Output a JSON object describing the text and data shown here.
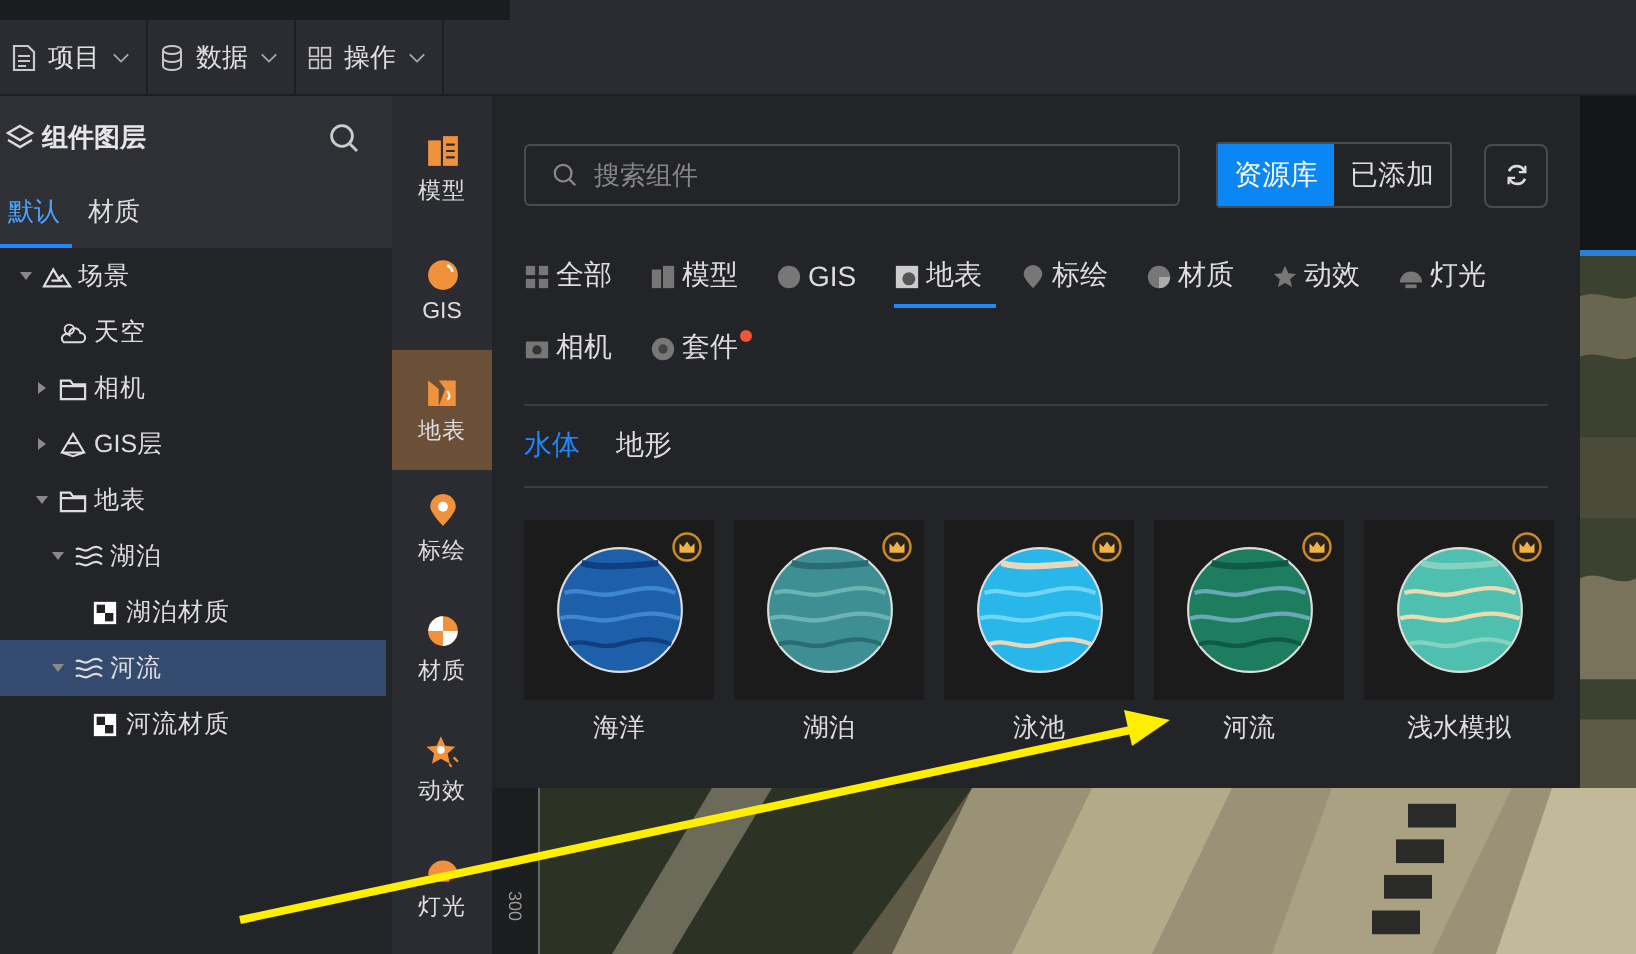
{
  "menu": [
    {
      "label": "项目"
    },
    {
      "label": "数据"
    },
    {
      "label": "操作"
    }
  ],
  "layers_panel": {
    "title": "组件图层",
    "tabs": [
      {
        "label": "默认",
        "selected": true
      },
      {
        "label": "材质",
        "selected": false
      }
    ],
    "tree": [
      {
        "label": "场景",
        "kind": "scene",
        "expanded": true,
        "selected": false,
        "children": [
          {
            "label": "天空",
            "kind": "sky",
            "selected": false
          },
          {
            "label": "相机",
            "kind": "folder",
            "expanded": false,
            "selected": false
          },
          {
            "label": "GIS层",
            "kind": "gis",
            "expanded": false,
            "selected": false
          },
          {
            "label": "地表",
            "kind": "folder",
            "expanded": true,
            "selected": false,
            "children": [
              {
                "label": "湖泊",
                "kind": "water",
                "expanded": true,
                "selected": false,
                "children": [
                  {
                    "label": "湖泊材质",
                    "kind": "material",
                    "selected": false
                  }
                ]
              },
              {
                "label": "河流",
                "kind": "water",
                "expanded": true,
                "selected": true,
                "children": [
                  {
                    "label": "河流材质",
                    "kind": "material",
                    "selected": false
                  }
                ]
              }
            ]
          }
        ]
      }
    ]
  },
  "rail": [
    {
      "label": "模型",
      "selected": false
    },
    {
      "label": "GIS",
      "selected": false
    },
    {
      "label": "地表",
      "selected": true
    },
    {
      "label": "标绘",
      "selected": false
    },
    {
      "label": "材质",
      "selected": false
    },
    {
      "label": "动效",
      "selected": false
    },
    {
      "label": "灯光",
      "selected": false
    }
  ],
  "library": {
    "search": {
      "placeholder": "搜索组件"
    },
    "source_toggle": [
      {
        "label": "资源库",
        "selected": true
      },
      {
        "label": "已添加",
        "selected": false
      }
    ],
    "categories": [
      {
        "label": "全部",
        "selected": false,
        "new": false
      },
      {
        "label": "模型",
        "selected": false,
        "new": false
      },
      {
        "label": "GIS",
        "selected": false,
        "new": false
      },
      {
        "label": "地表",
        "selected": true,
        "new": false
      },
      {
        "label": "标绘",
        "selected": false,
        "new": false
      },
      {
        "label": "材质",
        "selected": false,
        "new": false
      },
      {
        "label": "动效",
        "selected": false,
        "new": false
      },
      {
        "label": "灯光",
        "selected": false,
        "new": false
      },
      {
        "label": "相机",
        "selected": false,
        "new": false
      },
      {
        "label": "套件",
        "selected": false,
        "new": true
      }
    ],
    "subtabs": [
      {
        "label": "水体",
        "selected": true
      },
      {
        "label": "地形",
        "selected": false
      }
    ],
    "cards": [
      {
        "label": "海洋",
        "premium": true
      },
      {
        "label": "湖泊",
        "premium": true
      },
      {
        "label": "泳池",
        "premium": true
      },
      {
        "label": "河流",
        "premium": true
      },
      {
        "label": "浅水模拟",
        "premium": true
      }
    ]
  },
  "ruler": {
    "label": "300"
  }
}
